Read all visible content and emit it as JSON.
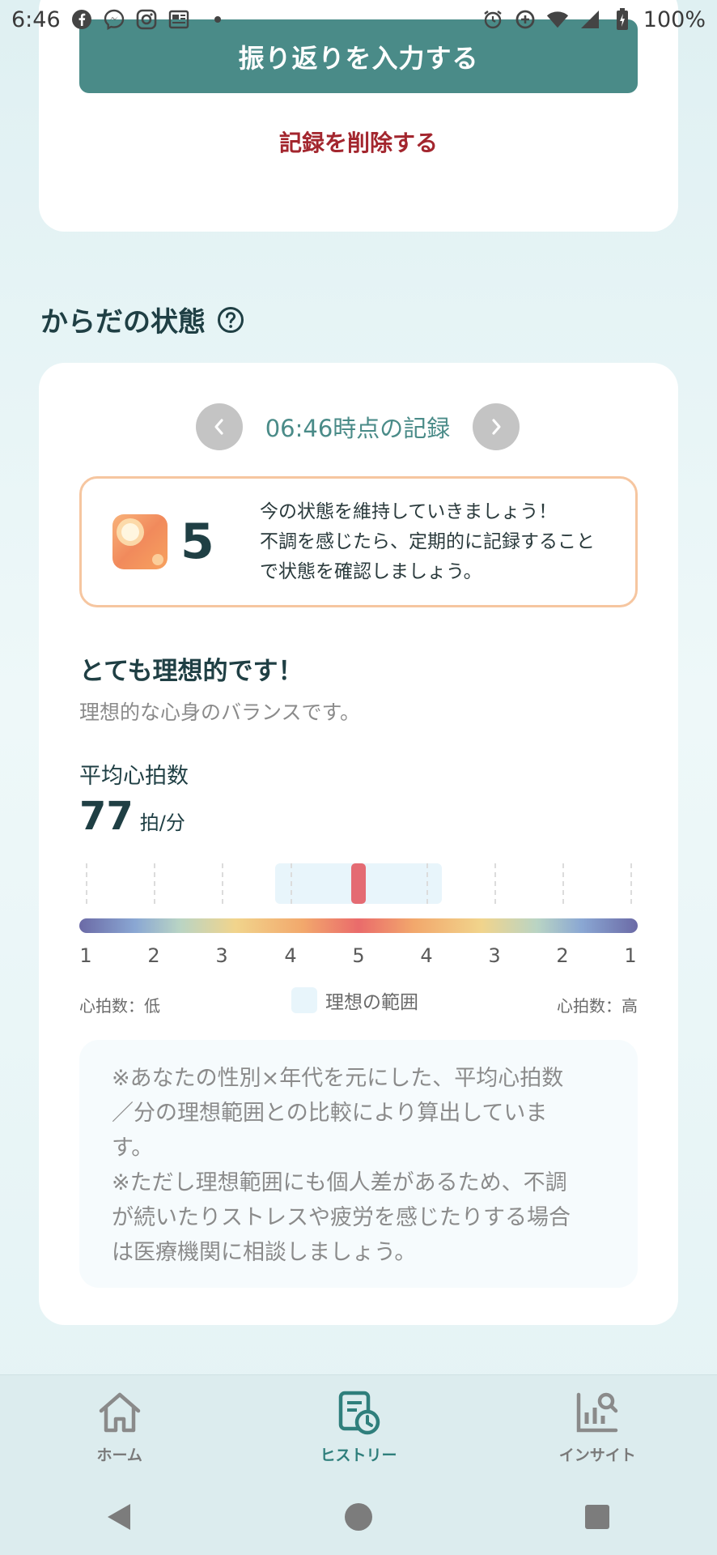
{
  "status_bar": {
    "time": "6:46",
    "battery": "100%",
    "icons": [
      "facebook-icon",
      "messenger-icon",
      "instagram-icon",
      "news-icon",
      "alarm-icon",
      "data-saver-icon",
      "wifi-icon",
      "signal-icon",
      "battery-icon"
    ]
  },
  "top_card": {
    "reflection_button": "振り返りを入力する",
    "delete_button": "記録を削除する"
  },
  "section": {
    "title": "からだの状態"
  },
  "record_nav": {
    "time_label": "06:46時点の記録"
  },
  "score": {
    "value": "5",
    "message_line1": "今の状態を維持していきましょう！",
    "message_line2": "不調を感じたら、定期的に記録すること",
    "message_line3": "で状態を確認しましょう。"
  },
  "evaluation": {
    "title": "とても理想的です！",
    "subtitle": "理想的な心身のバランスです。"
  },
  "heart_rate": {
    "label": "平均心拍数",
    "value": "77",
    "unit": "拍/分",
    "gauge_labels": [
      "1",
      "2",
      "3",
      "4",
      "5",
      "4",
      "3",
      "2",
      "1"
    ],
    "legend_low": "心拍数：低",
    "legend_ideal": "理想の範囲",
    "legend_high": "心拍数：高"
  },
  "note": {
    "line1": "※あなたの性別×年代を元にした、平均心拍数",
    "line2": "／分の理想範囲との比較により算出していま",
    "line3": "す。",
    "line4": "※ただし理想範囲にも個人差があるため、不調",
    "line5": "が続いたりストレスや疲労を感じたりする場合",
    "line6": "は医療機関に相談しましょう。"
  },
  "bottom_nav": {
    "home": "ホーム",
    "history": "ヒストリー",
    "insight": "インサイト"
  },
  "colors": {
    "primary": "#4a8b88",
    "danger": "#a3262e",
    "accent_active": "#2f7f7c",
    "marker": "#e46b73"
  }
}
